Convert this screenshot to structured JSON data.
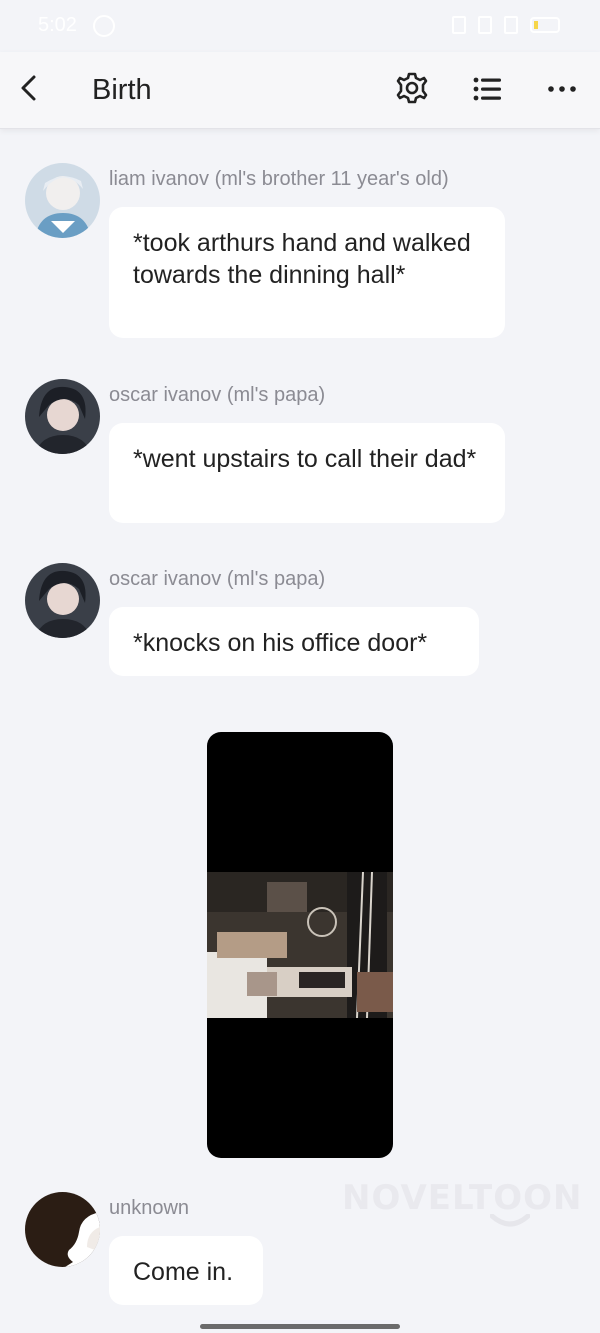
{
  "status_bar": {
    "time": "5:02",
    "icons": [
      "whatsapp-icon",
      "vibrate-icon",
      "alarm-icon",
      "signal-icon",
      "battery-icon"
    ]
  },
  "header": {
    "title": "Birth",
    "icons": [
      "back-icon",
      "gear-icon",
      "list-icon",
      "more-icon"
    ]
  },
  "messages": [
    {
      "sender": "liam ivanov (ml's brother 11 year's old)",
      "text": "*took arthurs hand and walked towards the dinning hall*"
    },
    {
      "sender": "oscar ivanov (ml's papa)",
      "text": "*went upstairs to call their dad*"
    },
    {
      "sender": "oscar ivanov (ml's papa)",
      "text": "*knocks on his office door*"
    },
    {
      "sender": "unknown",
      "text": "Come in."
    }
  ],
  "watermark": "NOVELTOON",
  "colors": {
    "background": "#f3f4f8",
    "bubble": "#ffffff",
    "sender_name": "#8b8b93",
    "text": "#222222"
  }
}
